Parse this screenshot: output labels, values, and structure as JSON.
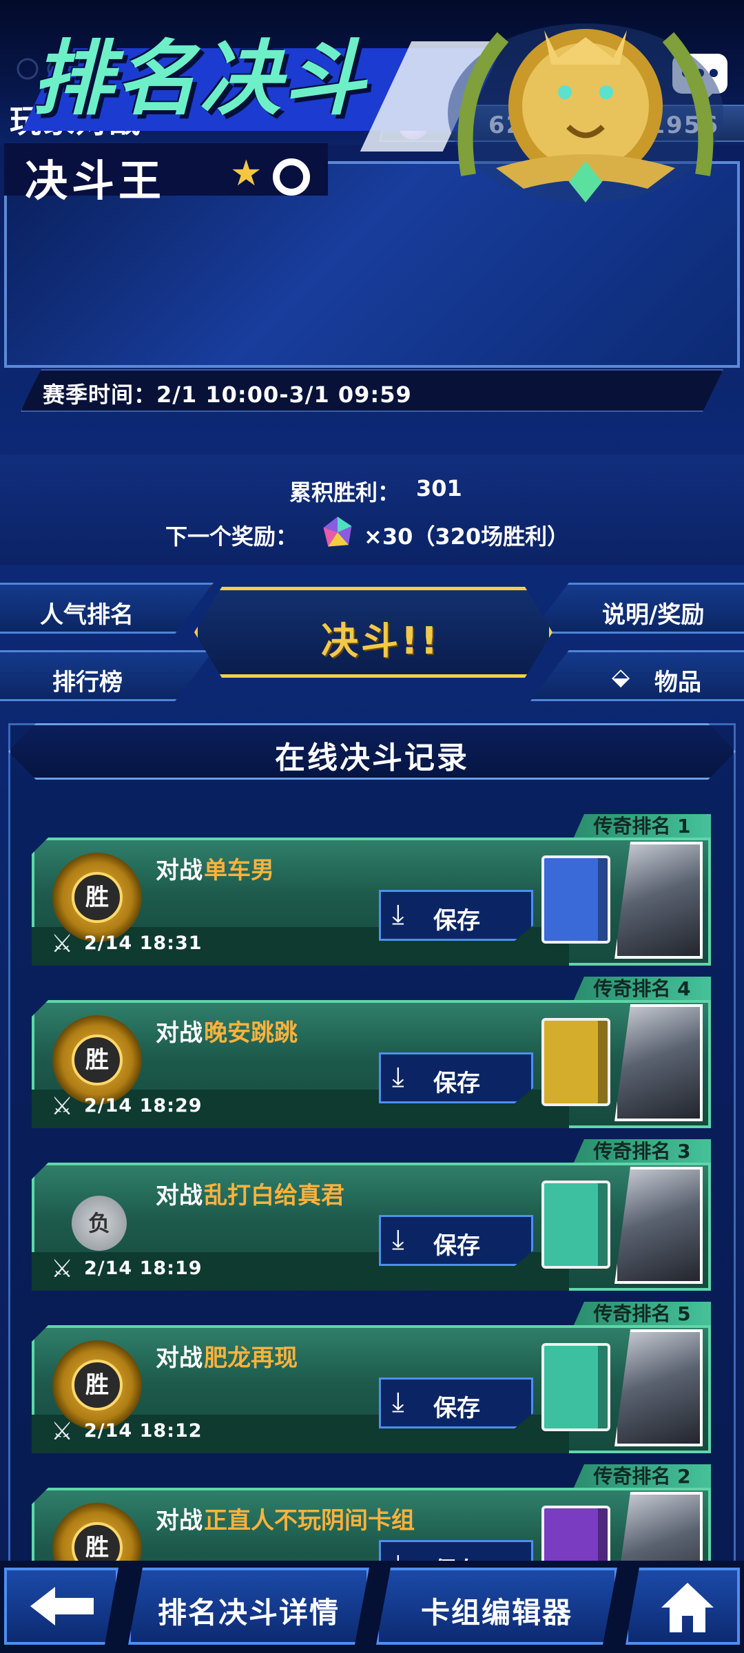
{
  "header": {
    "title": "玩家对战",
    "currencies": [
      {
        "icon": "orb-icon",
        "value": "620"
      },
      {
        "icon": "gem-icon",
        "value": "1956"
      }
    ]
  },
  "banner": {
    "title": "排名决斗",
    "rank_name": "决斗王",
    "rank_level": "0",
    "season_label": "赛季时间：",
    "season_period": "2/1 10:00-3/1 09:59"
  },
  "stats": {
    "wins_label": "累积胜利：",
    "wins_value": "301",
    "next_reward_label": "下一个奖励：",
    "next_reward_qty": "×30（320场胜利）"
  },
  "menu": {
    "popularity": "人气排名",
    "leaderboard": "排行榜",
    "duel": "决斗!!",
    "info_rewards": "说明/奖励",
    "items": "物品"
  },
  "records": {
    "title": "在线决斗记录",
    "vs_label": "对战",
    "save_label": "保存",
    "entries": [
      {
        "rank": "传奇排名 1",
        "result": "胜",
        "opponent": "单车男",
        "time": "2/14 18:31",
        "deck_color": "#3a6ad8"
      },
      {
        "rank": "传奇排名 4",
        "result": "胜",
        "opponent": "晚安跳跳",
        "time": "2/14 18:29",
        "deck_color": "#d4ad2c"
      },
      {
        "rank": "传奇排名 3",
        "result": "负",
        "opponent": "乱打白给真君",
        "time": "2/14 18:19",
        "deck_color": "#3cc0a0"
      },
      {
        "rank": "传奇排名 5",
        "result": "胜",
        "opponent": "肥龙再现",
        "time": "2/14 18:12",
        "deck_color": "#3cc0a0"
      },
      {
        "rank": "传奇排名 2",
        "result": "胜",
        "opponent": "正直人不玩阴间卡组",
        "time": "",
        "deck_color": "#7a3cc0"
      }
    ]
  },
  "bottom_nav": {
    "back": "back-arrow-icon",
    "details": "排名决斗详情",
    "deck_editor": "卡组编辑器",
    "home": "home-icon"
  },
  "colors": {
    "accent_gold": "#f3c94a",
    "card_green": "#2f7f6a",
    "opponent_orange": "#ffb23c"
  }
}
